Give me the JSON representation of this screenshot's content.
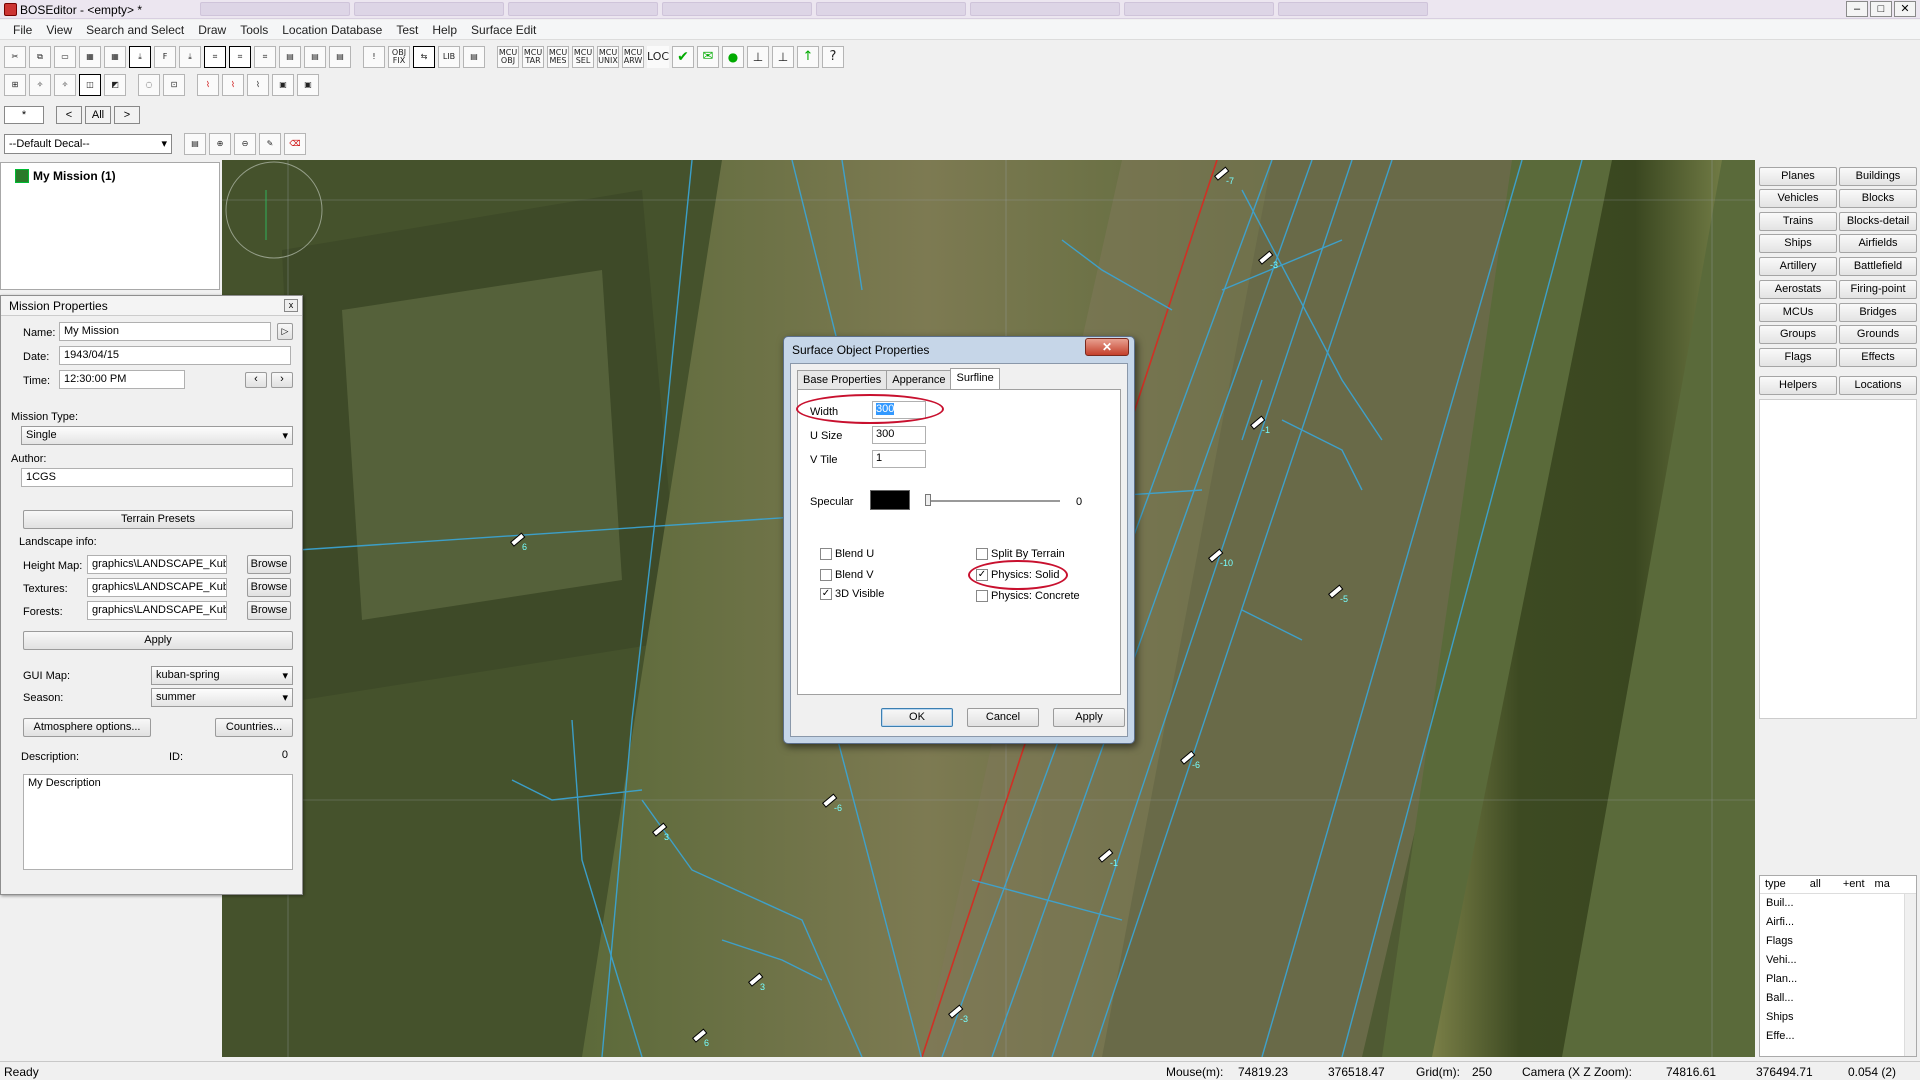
{
  "window": {
    "title": "BOSEditor - <empty> *",
    "controls": [
      "–",
      "□",
      "✕"
    ]
  },
  "menu": [
    "File",
    "View",
    "Search and Select",
    "Draw",
    "Tools",
    "Location Database",
    "Test",
    "Help",
    "Surface Edit"
  ],
  "toolbar1": [
    "✂",
    "⧉",
    "▭",
    "▦",
    "▦",
    "⤓",
    "F",
    "⤓",
    "⌗",
    "⌗",
    "⌗",
    "▤",
    "▤",
    "▤",
    "!",
    "OBJ FIX",
    "⇆",
    "LIB",
    "▤",
    "MCU OBJ",
    "MCU TAR",
    "MCU MES",
    "MCU SEL",
    "MCU UNIX",
    "MCU ARW",
    "LOC",
    "✔",
    "✉",
    "●",
    "⊥",
    "⊥",
    "↑",
    "?"
  ],
  "toolbar2": [
    "⊞",
    "✧",
    "✧",
    "◫",
    "◩",
    "◌",
    "⊡",
    "⌇",
    "⌇",
    "⌇",
    "▣",
    "▣"
  ],
  "filter": {
    "value": "*",
    "prev": "<",
    "all": "All",
    "next": ">"
  },
  "decal": {
    "selected": "--Default Decal--",
    "buttons": [
      "▤",
      "⊕",
      "⊖",
      "✎",
      "⌫"
    ]
  },
  "tree": {
    "root": "My Mission (1)"
  },
  "mission": {
    "title": "Mission Properties",
    "close": "x",
    "name_label": "Name:",
    "name": "My Mission",
    "date_label": "Date:",
    "date": "1943/04/15",
    "time_label": "Time:",
    "time": "12:30:00 PM",
    "type_label": "Mission Type:",
    "type": "Single",
    "author_label": "Author:",
    "author": "1CGS",
    "terrain_btn": "Terrain Presets",
    "landscape_label": "Landscape info:",
    "height_label": "Height Map:",
    "height": "graphics\\LANDSCAPE_Kuba",
    "textures_label": "Textures:",
    "textures": "graphics\\LANDSCAPE_Kuba",
    "forests_label": "Forests:",
    "forests": "graphics\\LANDSCAPE_Kuba",
    "browse": "Browse",
    "apply": "Apply",
    "gui_label": "GUI Map:",
    "gui": "kuban-spring",
    "season_label": "Season:",
    "season": "summer",
    "atmos_btn": "Atmosphere options...",
    "countries_btn": "Countries...",
    "desc_label": "Description:",
    "id_label": "ID:",
    "id": "0",
    "description": "My Description"
  },
  "dialog": {
    "title": "Surface Object Properties",
    "close": "✕",
    "tabs": [
      "Base Properties",
      "Apperance",
      "Surfline"
    ],
    "width_label": "Width",
    "width": "300",
    "usize_label": "U Size",
    "usize": "300",
    "vtile_label": "V Tile",
    "vtile": "1",
    "specular_label": "Specular",
    "specular_value": "0",
    "blend_u": "Blend U",
    "blend_v": "Blend V",
    "visible3d": "3D Visible",
    "split": "Split By Terrain",
    "phys_solid": "Physics: Solid",
    "phys_concrete": "Physics: Concrete",
    "ok": "OK",
    "cancel": "Cancel",
    "apply": "Apply",
    "colors": {
      "highlight": "#c8102e",
      "selection": "#3399ff"
    }
  },
  "categories": [
    [
      "Planes",
      "Buildings"
    ],
    [
      "Vehicles",
      "Blocks"
    ],
    [
      "Trains",
      "Blocks-detail"
    ],
    [
      "Ships",
      "Airfields"
    ],
    [
      "Artillery",
      "Battlefield"
    ],
    [
      "Aerostats",
      "Firing-point"
    ],
    [
      "MCUs",
      "Bridges"
    ],
    [
      "Groups",
      "Grounds"
    ],
    [
      "Flags",
      "Effects"
    ],
    [
      "Helpers",
      "Locations"
    ]
  ],
  "list": {
    "headers": [
      "type",
      "all",
      "+ent",
      "ma"
    ],
    "items": [
      "Buil...",
      "Airfi...",
      "Flags",
      "Vehi...",
      "Plan...",
      "Ball...",
      "Ships",
      "Effe..."
    ]
  },
  "map_markers": [
    "-7",
    "-3",
    "-1",
    "-10",
    "-5",
    "6",
    "-6",
    "-6",
    "3",
    "-1",
    "3",
    "-3",
    "6"
  ],
  "status": {
    "ready": "Ready",
    "mouse_label": "Mouse(m):",
    "mouse_x": "74819.23",
    "mouse_z": "376518.47",
    "grid_label": "Grid(m):",
    "grid": "250",
    "camera_label": "Camera (X Z Zoom):",
    "cam_x": "74816.61",
    "cam_z": "376494.71",
    "zoom": "0.054 (2)"
  }
}
